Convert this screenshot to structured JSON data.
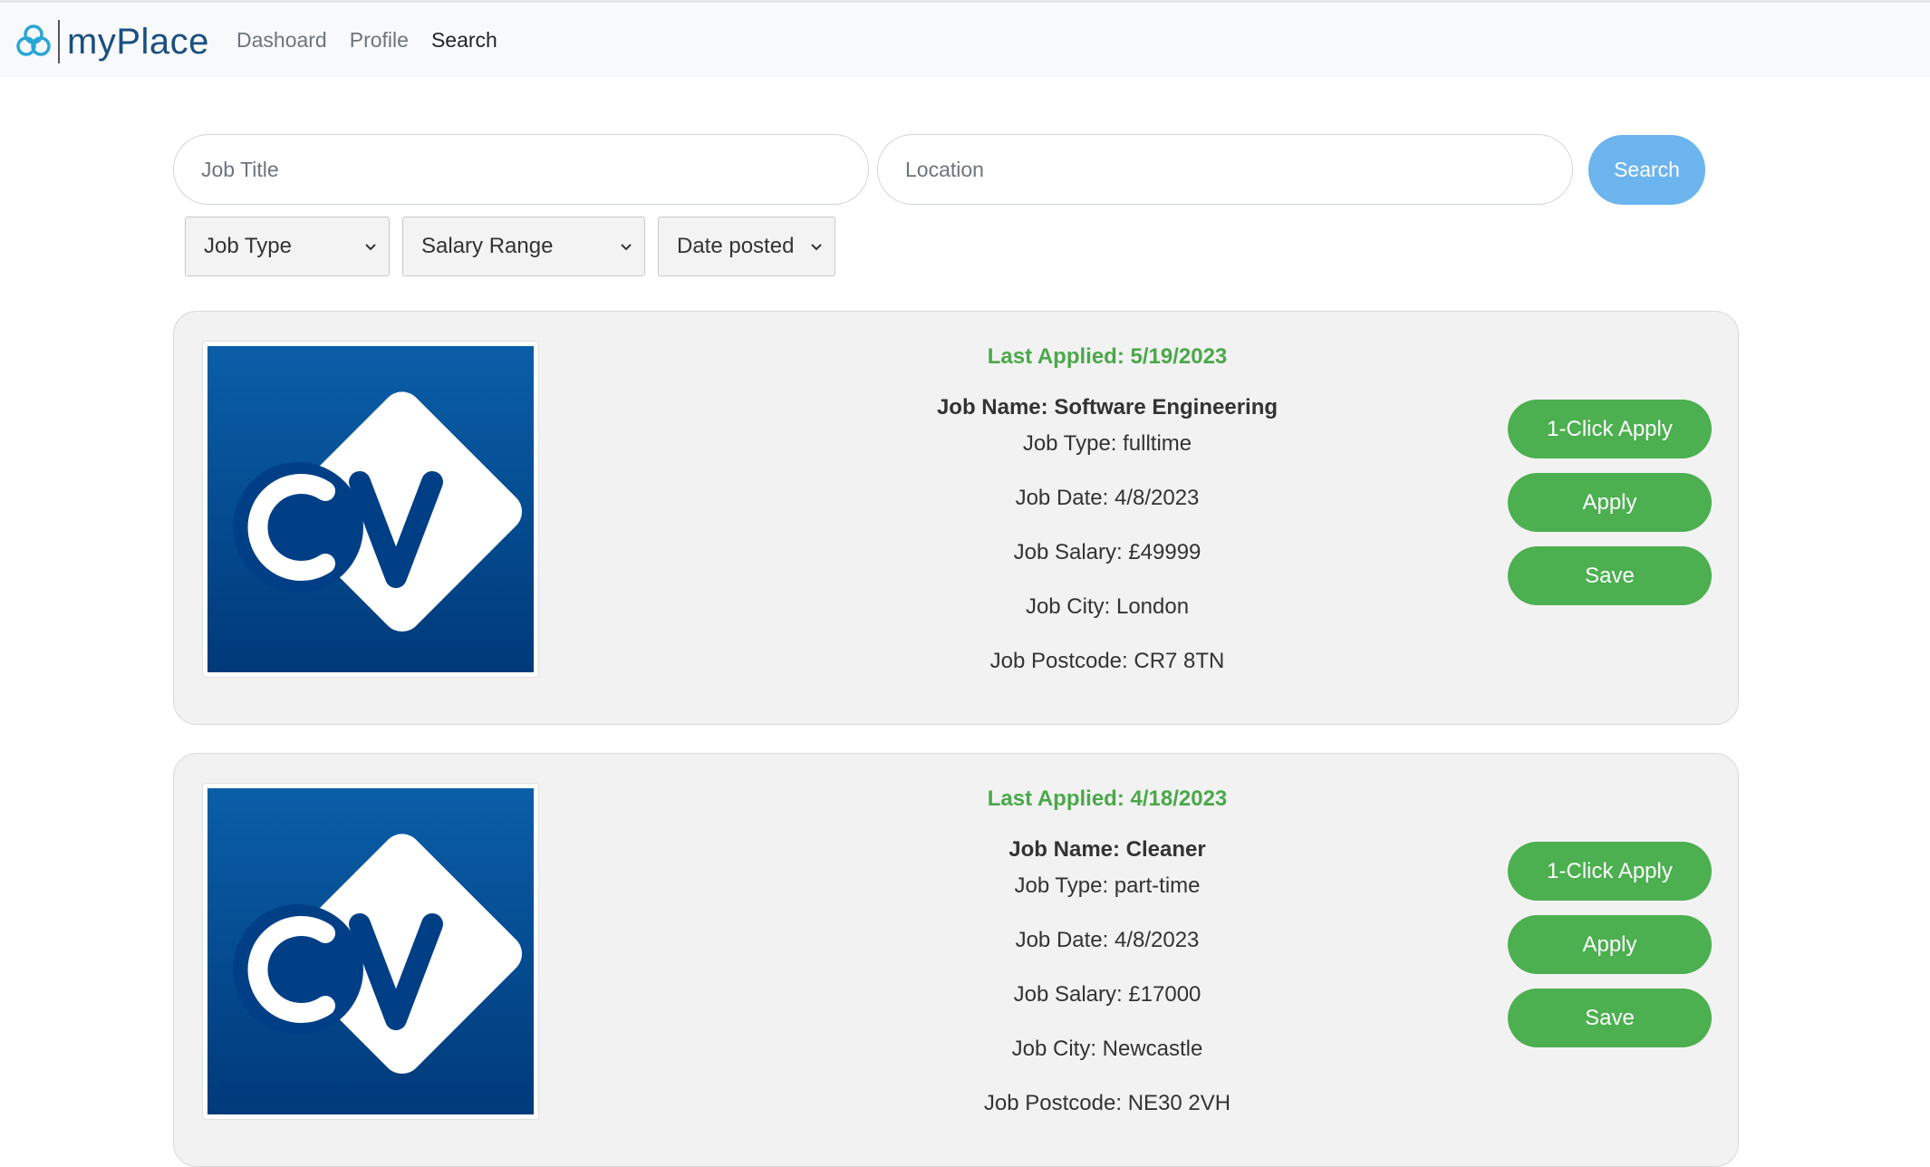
{
  "header": {
    "brand": "myPlace",
    "nav": [
      {
        "label": "Dashoard",
        "active": false
      },
      {
        "label": "Profile",
        "active": false
      },
      {
        "label": "Search",
        "active": true
      }
    ]
  },
  "search": {
    "job_title_placeholder": "Job Title",
    "location_placeholder": "Location",
    "button_label": "Search"
  },
  "filters": {
    "job_type": "Job Type",
    "salary_range": "Salary Range",
    "date_posted": "Date posted"
  },
  "colors": {
    "accent_green": "#4caf50",
    "last_applied_green": "#4aa84a",
    "search_button": "#6cb4ee",
    "brand_blue": "#1a4f80"
  },
  "jobs": [
    {
      "logo": "cv-logo",
      "last_applied": "Last Applied: 5/19/2023",
      "name": "Job Name: Software Engineering",
      "type": "Job Type: fulltime",
      "date": "Job Date: 4/8/2023",
      "salary": "Job Salary: £49999",
      "city": "Job City: London",
      "postcode": "Job Postcode: CR7 8TN",
      "buttons": {
        "one_click": "1-Click Apply",
        "apply": "Apply",
        "save": "Save"
      }
    },
    {
      "logo": "cv-logo",
      "last_applied": "Last Applied: 4/18/2023",
      "name": "Job Name: Cleaner",
      "type": "Job Type: part-time",
      "date": "Job Date: 4/8/2023",
      "salary": "Job Salary: £17000",
      "city": "Job City: Newcastle",
      "postcode": "Job Postcode: NE30 2VH",
      "buttons": {
        "one_click": "1-Click Apply",
        "apply": "Apply",
        "save": "Save"
      }
    }
  ]
}
